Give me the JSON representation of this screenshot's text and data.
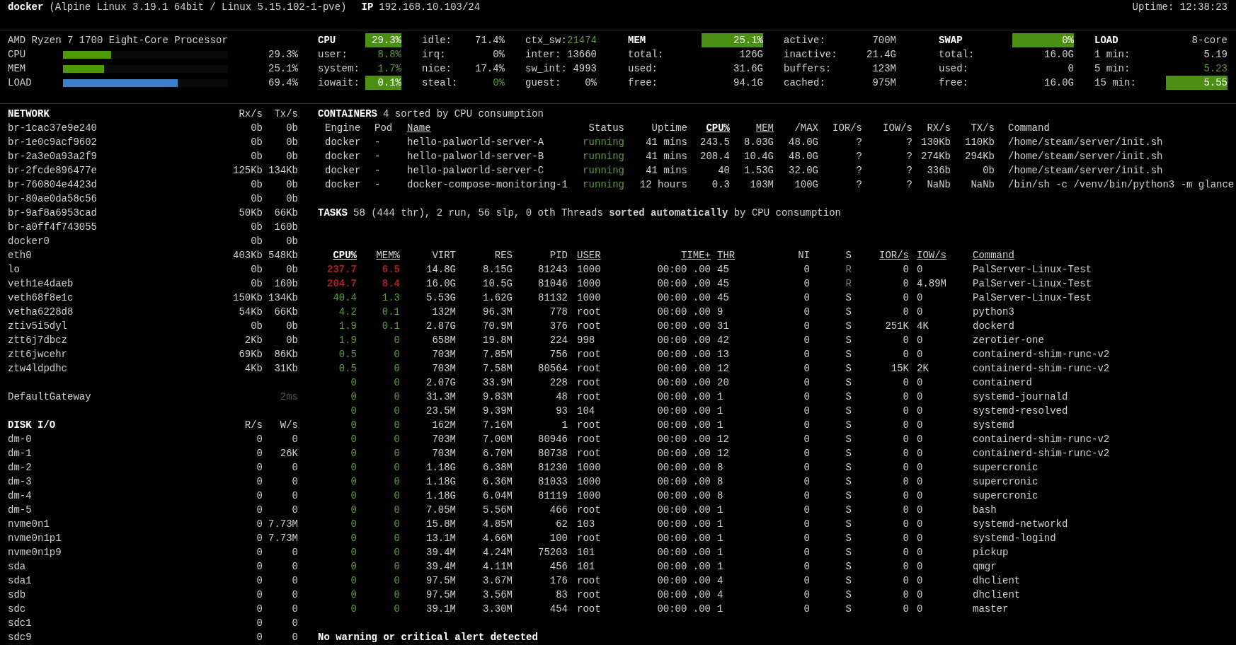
{
  "header": {
    "hostname": "docker",
    "system": "(Alpine Linux 3.19.1 64bit / Linux 5.15.102-1-pve)",
    "ip_label": "IP",
    "ip": "192.168.10.103/24",
    "uptime": "Uptime: 12:38:23"
  },
  "quicklook": {
    "processor": "AMD Ryzen 7 1700 Eight-Core Processor",
    "bars": [
      {
        "label": "CPU",
        "level": 0.293,
        "value": "29.3%",
        "color": "#4e9a06"
      },
      {
        "label": "MEM",
        "level": 0.251,
        "value": "25.1%",
        "color": "#4e9a06"
      },
      {
        "label": "LOAD",
        "level": 0.694,
        "value": "69.4%",
        "color": "#3d7fc8"
      }
    ]
  },
  "stats": [
    {
      "kind": "cpu",
      "columns": [
        [
          {
            "kind": "title",
            "label": "CPU",
            "value": "29.3%",
            "highlighted": true
          },
          {
            "kind": "stat",
            "label": "user:",
            "value": "8.8%",
            "ok": true,
            "highlighted": false
          },
          {
            "kind": "stat",
            "label": "system:",
            "value": "1.7%",
            "ok": true,
            "highlighted": false
          },
          {
            "kind": "stat",
            "label": "iowait:",
            "value": "0.1%",
            "highlighted": true
          }
        ],
        [
          {
            "kind": "stat",
            "label": "idle:",
            "value": "71.4%",
            "ok": false,
            "highlighted": false
          },
          {
            "kind": "stat",
            "label": "irq:",
            "value": "0%",
            "ok": false,
            "highlighted": false
          },
          {
            "kind": "stat",
            "label": "nice:",
            "value": "17.4%",
            "ok": false,
            "highlighted": false
          },
          {
            "kind": "stat",
            "label": "steal:",
            "value": "0%",
            "ok": true,
            "highlighted": false
          }
        ],
        [
          {
            "kind": "stat",
            "label": "ctx_sw:",
            "value": "21474",
            "ok": true,
            "highlighted": false
          },
          {
            "kind": "stat",
            "label": "inter:",
            "value": "13660",
            "ok": false,
            "highlighted": false
          },
          {
            "kind": "stat",
            "label": "sw_int:",
            "value": "4993",
            "ok": false,
            "highlighted": false
          },
          {
            "kind": "stat",
            "label": "guest:",
            "value": "0%",
            "ok": false,
            "highlighted": false
          }
        ]
      ]
    },
    {
      "kind": "mem",
      "columns": [
        [
          {
            "kind": "title",
            "label": "MEM",
            "value": "25.1%",
            "highlighted": true
          },
          {
            "kind": "stat",
            "label": "total:",
            "value": "126G",
            "ok": false,
            "highlighted": false
          },
          {
            "kind": "stat",
            "label": "used:",
            "value": "31.6G",
            "ok": false,
            "highlighted": false
          },
          {
            "kind": "stat",
            "label": "free:",
            "value": "94.1G",
            "ok": false,
            "highlighted": false
          }
        ],
        [
          {
            "kind": "stat",
            "label": "active:",
            "value": "700M",
            "ok": false,
            "highlighted": false
          },
          {
            "kind": "stat",
            "label": "inactive:",
            "value": "21.4G",
            "ok": false,
            "highlighted": false
          },
          {
            "kind": "stat",
            "label": "buffers:",
            "value": "123M",
            "ok": false,
            "highlighted": false
          },
          {
            "kind": "stat",
            "label": "cached:",
            "value": "975M",
            "ok": false,
            "highlighted": false
          }
        ]
      ]
    },
    {
      "kind": "swap",
      "columns": [
        [
          {
            "kind": "title",
            "label": "SWAP",
            "value": "0%",
            "highlighted": true
          },
          {
            "kind": "stat",
            "label": "total:",
            "value": "16.0G",
            "ok": false,
            "highlighted": false
          },
          {
            "kind": "stat",
            "label": "used:",
            "value": "0",
            "ok": false,
            "highlighted": false
          },
          {
            "kind": "stat",
            "label": "free:",
            "value": "16.0G",
            "ok": false,
            "highlighted": false
          }
        ]
      ]
    },
    {
      "kind": "load",
      "columns": [
        [
          {
            "kind": "title",
            "label": "LOAD",
            "value": "8-core",
            "ok": false,
            "highlighted": false
          },
          {
            "kind": "stat",
            "label": "1 min:",
            "value": "5.19",
            "ok": false,
            "highlighted": false
          },
          {
            "kind": "stat",
            "label": "5 min:",
            "value": "5.23",
            "ok": true,
            "highlighted": false
          },
          {
            "kind": "stat",
            "label": "15 min:",
            "value": "5.55",
            "highlighted": true
          }
        ]
      ]
    }
  ],
  "network": {
    "title": "NETWORK",
    "columns": [
      "Rx/s",
      "Tx/s"
    ],
    "rows": [
      {
        "name": "br-1cac37e9e240",
        "rx": "0b",
        "tx": "0b"
      },
      {
        "name": "br-1e0c9acf9602",
        "rx": "0b",
        "tx": "0b"
      },
      {
        "name": "br-2a3e0a93a2f9",
        "rx": "0b",
        "tx": "0b"
      },
      {
        "name": "br-2fcde896477e",
        "rx": "125Kb",
        "tx": "134Kb"
      },
      {
        "name": "br-760804e4423d",
        "rx": "0b",
        "tx": "0b"
      },
      {
        "name": "br-80ae0da58c56",
        "rx": "0b",
        "tx": "0b"
      },
      {
        "name": "br-9af8a6953cad",
        "rx": "50Kb",
        "tx": "66Kb"
      },
      {
        "name": "br-a0ff4f743055",
        "rx": "0b",
        "tx": "160b"
      },
      {
        "name": "docker0",
        "rx": "0b",
        "tx": "0b"
      },
      {
        "name": "eth0",
        "rx": "403Kb",
        "tx": "548Kb"
      },
      {
        "name": "lo",
        "rx": "0b",
        "tx": "0b"
      },
      {
        "name": "veth1e4daeb",
        "rx": "0b",
        "tx": "160b"
      },
      {
        "name": "veth68f8e1c",
        "rx": "150Kb",
        "tx": "134Kb"
      },
      {
        "name": "vetha6228d8",
        "rx": "54Kb",
        "tx": "66Kb"
      },
      {
        "name": "ztiv5i5dyl",
        "rx": "0b",
        "tx": "0b"
      },
      {
        "name": "ztt6j7dbcz",
        "rx": "2Kb",
        "tx": "0b"
      },
      {
        "name": "ztt6jwcehr",
        "rx": "69Kb",
        "tx": "86Kb"
      },
      {
        "name": "ztw4ldpdhc",
        "rx": "4Kb",
        "tx": "31Kb"
      }
    ]
  },
  "gateway": {
    "name": "DefaultGateway",
    "value": "2ms"
  },
  "disk_io": {
    "title": "DISK I/O",
    "columns": [
      "R/s",
      "W/s"
    ],
    "rows": [
      {
        "name": "dm-0",
        "rx": "0",
        "tx": "0"
      },
      {
        "name": "dm-1",
        "rx": "0",
        "tx": "26K"
      },
      {
        "name": "dm-2",
        "rx": "0",
        "tx": "0"
      },
      {
        "name": "dm-3",
        "rx": "0",
        "tx": "0"
      },
      {
        "name": "dm-4",
        "rx": "0",
        "tx": "0"
      },
      {
        "name": "dm-5",
        "rx": "0",
        "tx": "0"
      },
      {
        "name": "nvme0n1",
        "rx": "0",
        "tx": "7.73M"
      },
      {
        "name": "nvme0n1p1",
        "rx": "0",
        "tx": "7.73M"
      },
      {
        "name": "nvme0n1p9",
        "rx": "0",
        "tx": "0"
      },
      {
        "name": "sda",
        "rx": "0",
        "tx": "0"
      },
      {
        "name": "sda1",
        "rx": "0",
        "tx": "0"
      },
      {
        "name": "sdb",
        "rx": "0",
        "tx": "0"
      },
      {
        "name": "sdc",
        "rx": "0",
        "tx": "0"
      },
      {
        "name": "sdc1",
        "rx": "0",
        "tx": "0"
      },
      {
        "name": "sdc9",
        "rx": "0",
        "tx": "0"
      }
    ]
  },
  "containers": {
    "title": "CONTAINERS",
    "summary": "4 sorted by CPU consumption",
    "columns": [
      {
        "label": "Engine",
        "sortable": false,
        "selected": false
      },
      {
        "label": "Pod",
        "sortable": false,
        "selected": false
      },
      {
        "label": "Name",
        "sortable": true,
        "selected": false
      },
      {
        "label": "Status",
        "sortable": false,
        "selected": false
      },
      {
        "label": "Uptime",
        "sortable": false,
        "selected": false
      },
      {
        "label": "CPU%",
        "sortable": true,
        "selected": true
      },
      {
        "label": "MEM",
        "sortable": true,
        "selected": false
      },
      {
        "label": "/MAX",
        "sortable": false,
        "selected": false
      },
      {
        "label": "IOR/s",
        "sortable": false,
        "selected": false
      },
      {
        "label": "IOW/s",
        "sortable": false,
        "selected": false
      },
      {
        "label": "RX/s",
        "sortable": false,
        "selected": false
      },
      {
        "label": "TX/s",
        "sortable": false,
        "selected": false
      },
      {
        "label": "Command",
        "sortable": false,
        "selected": false
      }
    ],
    "rows": [
      {
        "healthy": true,
        "cells": [
          "docker",
          "-",
          "hello-palworld-server-A",
          "running",
          "41 mins",
          "243.5",
          "8.03G",
          "48.0G",
          "?",
          "?",
          "130Kb",
          "110Kb",
          "/home/steam/server/init.sh"
        ]
      },
      {
        "healthy": true,
        "cells": [
          "docker",
          "-",
          "hello-palworld-server-B",
          "running",
          "41 mins",
          "208.4",
          "10.4G",
          "48.0G",
          "?",
          "?",
          "274Kb",
          "294Kb",
          "/home/steam/server/init.sh"
        ]
      },
      {
        "healthy": true,
        "cells": [
          "docker",
          "-",
          "hello-palworld-server-C",
          "running",
          "41 mins",
          "40",
          "1.53G",
          "32.0G",
          "?",
          "?",
          "336b",
          "0b",
          "/home/steam/server/init.sh"
        ]
      },
      {
        "healthy": true,
        "cells": [
          "docker",
          "-",
          "docker-compose-monitoring-1",
          "running",
          "12 hours",
          "0.3",
          "103M",
          "100G",
          "?",
          "?",
          "NaNb",
          "NaNb",
          "/bin/sh -c /venv/bin/python3 -m glance"
        ]
      }
    ]
  },
  "tasks": {
    "title": "TASKS",
    "summary": "58 (444 thr), 2 run, 56 slp, 0 oth Threads **sorted automatically** by CPU consumption",
    "columns": [
      {
        "label": "CPU%",
        "sortable": true,
        "selected": true
      },
      {
        "label": "MEM%",
        "sortable": true,
        "selected": false
      },
      {
        "label": "VIRT",
        "sortable": false,
        "selected": false
      },
      {
        "label": "RES",
        "sortable": false,
        "selected": false
      },
      {
        "label": "PID",
        "sortable": false,
        "selected": false
      },
      {
        "label": "USER",
        "sortable": true,
        "selected": false
      },
      {
        "label": "TIME+",
        "sortable": true,
        "selected": false
      },
      {
        "label": "THR",
        "sortable": true,
        "selected": false
      },
      {
        "label": "NI",
        "sortable": false,
        "selected": false
      },
      {
        "label": "S",
        "sortable": false,
        "selected": false
      },
      {
        "label": "IOR/s",
        "sortable": true,
        "selected": false
      },
      {
        "label": "IOW/s",
        "sortable": true,
        "selected": false
      },
      {
        "label": "Command",
        "sortable": true,
        "selected": false
      }
    ],
    "rows": [
      {
        "cpu_critical": true,
        "mem_critical": true,
        "running": true,
        "cells": [
          "237.7",
          "6.5",
          "14.8G",
          "8.15G",
          "81243",
          "1000",
          "00:00 .00",
          "45",
          "0",
          "R",
          "0",
          "0",
          "PalServer-Linux-Test"
        ]
      },
      {
        "cpu_critical": true,
        "mem_critical": true,
        "running": true,
        "cells": [
          "204.7",
          "8.4",
          "16.0G",
          "10.5G",
          "81046",
          "1000",
          "00:00 .00",
          "45",
          "0",
          "R",
          "0",
          "4.89M",
          "PalServer-Linux-Test"
        ]
      },
      {
        "cpu_critical": false,
        "mem_critical": false,
        "running": false,
        "cells": [
          "40.4",
          "1.3",
          "5.53G",
          "1.62G",
          "81132",
          "1000",
          "00:00 .00",
          "45",
          "0",
          "S",
          "0",
          "0",
          "PalServer-Linux-Test"
        ]
      },
      {
        "cpu_critical": false,
        "mem_critical": false,
        "running": false,
        "cells": [
          "4.2",
          "0.1",
          "132M",
          "96.3M",
          "778",
          "root",
          "00:00 .00",
          "9",
          "0",
          "S",
          "0",
          "0",
          "python3"
        ]
      },
      {
        "cpu_critical": false,
        "mem_critical": false,
        "running": false,
        "cells": [
          "1.9",
          "0.1",
          "2.87G",
          "70.9M",
          "376",
          "root",
          "00:00 .00",
          "31",
          "0",
          "S",
          "251K",
          "4K",
          "dockerd"
        ]
      },
      {
        "cpu_critical": false,
        "mem_critical": false,
        "running": false,
        "cells": [
          "1.9",
          "0",
          "658M",
          "19.8M",
          "224",
          "998",
          "00:00 .00",
          "42",
          "0",
          "S",
          "0",
          "0",
          "zerotier-one"
        ]
      },
      {
        "cpu_critical": false,
        "mem_critical": false,
        "running": false,
        "cells": [
          "0.5",
          "0",
          "703M",
          "7.85M",
          "756",
          "root",
          "00:00 .00",
          "13",
          "0",
          "S",
          "0",
          "0",
          "containerd-shim-runc-v2"
        ]
      },
      {
        "cpu_critical": false,
        "mem_critical": false,
        "running": false,
        "cells": [
          "0.5",
          "0",
          "703M",
          "7.58M",
          "80564",
          "root",
          "00:00 .00",
          "12",
          "0",
          "S",
          "15K",
          "2K",
          "containerd-shim-runc-v2"
        ]
      },
      {
        "cpu_critical": false,
        "mem_critical": false,
        "running": false,
        "cells": [
          "0",
          "0",
          "2.07G",
          "33.9M",
          "228",
          "root",
          "00:00 .00",
          "20",
          "0",
          "S",
          "0",
          "0",
          "containerd"
        ]
      },
      {
        "cpu_critical": false,
        "mem_critical": false,
        "running": false,
        "cells": [
          "0",
          "0",
          "31.3M",
          "9.83M",
          "48",
          "root",
          "00:00 .00",
          "1",
          "0",
          "S",
          "0",
          "0",
          "systemd-journald"
        ]
      },
      {
        "cpu_critical": false,
        "mem_critical": false,
        "running": false,
        "cells": [
          "0",
          "0",
          "23.5M",
          "9.39M",
          "93",
          "104",
          "00:00 .00",
          "1",
          "0",
          "S",
          "0",
          "0",
          "systemd-resolved"
        ]
      },
      {
        "cpu_critical": false,
        "mem_critical": false,
        "running": false,
        "cells": [
          "0",
          "0",
          "162M",
          "7.16M",
          "1",
          "root",
          "00:00 .00",
          "1",
          "0",
          "S",
          "0",
          "0",
          "systemd"
        ]
      },
      {
        "cpu_critical": false,
        "mem_critical": false,
        "running": false,
        "cells": [
          "0",
          "0",
          "703M",
          "7.00M",
          "80946",
          "root",
          "00:00 .00",
          "12",
          "0",
          "S",
          "0",
          "0",
          "containerd-shim-runc-v2"
        ]
      },
      {
        "cpu_critical": false,
        "mem_critical": false,
        "running": false,
        "cells": [
          "0",
          "0",
          "703M",
          "6.70M",
          "80738",
          "root",
          "00:00 .00",
          "12",
          "0",
          "S",
          "0",
          "0",
          "containerd-shim-runc-v2"
        ]
      },
      {
        "cpu_critical": false,
        "mem_critical": false,
        "running": false,
        "cells": [
          "0",
          "0",
          "1.18G",
          "6.38M",
          "81230",
          "1000",
          "00:00 .00",
          "8",
          "0",
          "S",
          "0",
          "0",
          "supercronic"
        ]
      },
      {
        "cpu_critical": false,
        "mem_critical": false,
        "running": false,
        "cells": [
          "0",
          "0",
          "1.18G",
          "6.36M",
          "81033",
          "1000",
          "00:00 .00",
          "8",
          "0",
          "S",
          "0",
          "0",
          "supercronic"
        ]
      },
      {
        "cpu_critical": false,
        "mem_critical": false,
        "running": false,
        "cells": [
          "0",
          "0",
          "1.18G",
          "6.04M",
          "81119",
          "1000",
          "00:00 .00",
          "8",
          "0",
          "S",
          "0",
          "0",
          "supercronic"
        ]
      },
      {
        "cpu_critical": false,
        "mem_critical": false,
        "running": false,
        "cells": [
          "0",
          "0",
          "7.05M",
          "5.56M",
          "466",
          "root",
          "00:00 .00",
          "1",
          "0",
          "S",
          "0",
          "0",
          "bash"
        ]
      },
      {
        "cpu_critical": false,
        "mem_critical": false,
        "running": false,
        "cells": [
          "0",
          "0",
          "15.8M",
          "4.85M",
          "62",
          "103",
          "00:00 .00",
          "1",
          "0",
          "S",
          "0",
          "0",
          "systemd-networkd"
        ]
      },
      {
        "cpu_critical": false,
        "mem_critical": false,
        "running": false,
        "cells": [
          "0",
          "0",
          "13.1M",
          "4.66M",
          "100",
          "root",
          "00:00 .00",
          "1",
          "0",
          "S",
          "0",
          "0",
          "systemd-logind"
        ]
      },
      {
        "cpu_critical": false,
        "mem_critical": false,
        "running": false,
        "cells": [
          "0",
          "0",
          "39.4M",
          "4.24M",
          "75203",
          "101",
          "00:00 .00",
          "1",
          "0",
          "S",
          "0",
          "0",
          "pickup"
        ]
      },
      {
        "cpu_critical": false,
        "mem_critical": false,
        "running": false,
        "cells": [
          "0",
          "0",
          "39.4M",
          "4.11M",
          "456",
          "101",
          "00:00 .00",
          "1",
          "0",
          "S",
          "0",
          "0",
          "qmgr"
        ]
      },
      {
        "cpu_critical": false,
        "mem_critical": false,
        "running": false,
        "cells": [
          "0",
          "0",
          "97.5M",
          "3.67M",
          "176",
          "root",
          "00:00 .00",
          "4",
          "0",
          "S",
          "0",
          "0",
          "dhclient"
        ]
      },
      {
        "cpu_critical": false,
        "mem_critical": false,
        "running": false,
        "cells": [
          "0",
          "0",
          "97.5M",
          "3.56M",
          "83",
          "root",
          "00:00 .00",
          "4",
          "0",
          "S",
          "0",
          "0",
          "dhclient"
        ]
      },
      {
        "cpu_critical": false,
        "mem_critical": false,
        "running": false,
        "cells": [
          "0",
          "0",
          "39.1M",
          "3.30M",
          "454",
          "root",
          "00:00 .00",
          "1",
          "0",
          "S",
          "0",
          "0",
          "master"
        ]
      }
    ]
  },
  "alert": "No warning or critical alert detected"
}
